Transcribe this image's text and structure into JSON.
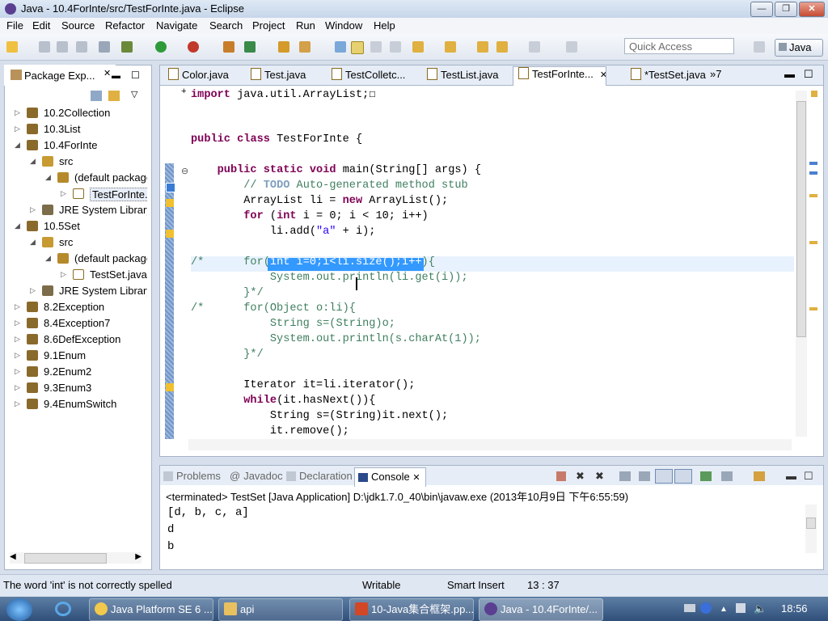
{
  "window": {
    "title": "Java - 10.4ForInte/src/TestForInte.java - Eclipse",
    "min": "—",
    "max": "❐",
    "close": "✕"
  },
  "menu": [
    "File",
    "Edit",
    "Source",
    "Refactor",
    "Navigate",
    "Search",
    "Project",
    "Run",
    "Window",
    "Help"
  ],
  "toolbar": {
    "quick_access_placeholder": "Quick Access",
    "perspective": "Java"
  },
  "package_explorer": {
    "title": "Package Exp...",
    "tree": [
      {
        "label": "10.2Collection",
        "level": 0,
        "twisty": "▷",
        "icon": "proj"
      },
      {
        "label": "10.3List",
        "level": 0,
        "twisty": "▷",
        "icon": "proj"
      },
      {
        "label": "10.4ForInte",
        "level": 0,
        "twisty": "◢",
        "icon": "proj"
      },
      {
        "label": "src",
        "level": 1,
        "twisty": "◢",
        "icon": "src"
      },
      {
        "label": "(default package)",
        "level": 2,
        "twisty": "◢",
        "icon": "pkg"
      },
      {
        "label": "TestForInte.java",
        "level": 3,
        "twisty": "▷",
        "icon": "jfile"
      },
      {
        "label": "JRE System Library",
        "level": 1,
        "twisty": "▷",
        "icon": "lib"
      },
      {
        "label": "10.5Set",
        "level": 0,
        "twisty": "◢",
        "icon": "proj"
      },
      {
        "label": "src",
        "level": 1,
        "twisty": "◢",
        "icon": "src"
      },
      {
        "label": "(default package)",
        "level": 2,
        "twisty": "◢",
        "icon": "pkg"
      },
      {
        "label": "TestSet.java",
        "level": 3,
        "twisty": "▷",
        "icon": "jfile"
      },
      {
        "label": "JRE System Library",
        "level": 1,
        "twisty": "▷",
        "icon": "lib"
      },
      {
        "label": "8.2Exception",
        "level": 0,
        "twisty": "▷",
        "icon": "proj"
      },
      {
        "label": "8.4Exception7",
        "level": 0,
        "twisty": "▷",
        "icon": "proj"
      },
      {
        "label": "8.6DefException",
        "level": 0,
        "twisty": "▷",
        "icon": "proj"
      },
      {
        "label": "9.1Enum",
        "level": 0,
        "twisty": "▷",
        "icon": "proj"
      },
      {
        "label": "9.2Enum2",
        "level": 0,
        "twisty": "▷",
        "icon": "proj"
      },
      {
        "label": "9.3Enum3",
        "level": 0,
        "twisty": "▷",
        "icon": "proj"
      },
      {
        "label": "9.4EnumSwitch",
        "level": 0,
        "twisty": "▷",
        "icon": "proj"
      }
    ]
  },
  "editor": {
    "tabs": [
      {
        "label": "Color.java",
        "active": false
      },
      {
        "label": "Test.java",
        "active": false
      },
      {
        "label": "TestColletc...",
        "active": false
      },
      {
        "label": "TestList.java",
        "active": false
      },
      {
        "label": "TestForInte...",
        "active": true,
        "close": "✕"
      },
      {
        "label": "*TestSet.java",
        "active": false
      }
    ],
    "overflow": "»7"
  },
  "code_lines": [
    {
      "parts": [
        {
          "t": "+",
          "c": ""
        },
        {
          "t": "import",
          "c": "kw"
        },
        {
          "t": " java.util.ArrayList;",
          "c": ""
        },
        {
          "t": "☐",
          "c": ""
        }
      ]
    },
    {
      "parts": []
    },
    {
      "parts": []
    },
    {
      "parts": [
        {
          "t": "public",
          "c": "kw"
        },
        {
          "t": " ",
          "c": ""
        },
        {
          "t": "class",
          "c": "kw"
        },
        {
          "t": " TestForInte {",
          "c": ""
        }
      ]
    },
    {
      "parts": []
    },
    {
      "parts": [
        {
          "t": "    ",
          "c": ""
        },
        {
          "t": "public",
          "c": "kw"
        },
        {
          "t": " ",
          "c": ""
        },
        {
          "t": "static",
          "c": "kw"
        },
        {
          "t": " ",
          "c": ""
        },
        {
          "t": "void",
          "c": "kw"
        },
        {
          "t": " main(String[] args) {",
          "c": ""
        }
      ]
    },
    {
      "parts": [
        {
          "t": "        ",
          "c": ""
        },
        {
          "t": "// ",
          "c": "cm"
        },
        {
          "t": "TODO",
          "c": "cmk"
        },
        {
          "t": " Auto-generated method stub",
          "c": "cm"
        }
      ]
    },
    {
      "parts": [
        {
          "t": "        ArrayList li = ",
          "c": ""
        },
        {
          "t": "new",
          "c": "kw"
        },
        {
          "t": " ArrayList();",
          "c": ""
        }
      ]
    },
    {
      "parts": [
        {
          "t": "        ",
          "c": ""
        },
        {
          "t": "for",
          "c": "kw"
        },
        {
          "t": " (",
          "c": ""
        },
        {
          "t": "int",
          "c": "kw"
        },
        {
          "t": " i = 0; i < 10; i++)",
          "c": ""
        }
      ]
    },
    {
      "parts": [
        {
          "t": "            li.add(",
          "c": ""
        },
        {
          "t": "\"a\"",
          "c": "str"
        },
        {
          "t": " + i);",
          "c": ""
        }
      ]
    },
    {
      "parts": []
    },
    {
      "parts": [
        {
          "t": "/*      for(",
          "c": "cm"
        },
        {
          "t": "int i=0;i<li.size();i++",
          "c": "cm"
        },
        {
          "t": "){",
          "c": "cm"
        }
      ]
    },
    {
      "parts": [
        {
          "t": "            System.out.println(li.get(i));",
          "c": "cm"
        }
      ]
    },
    {
      "parts": [
        {
          "t": "        }*/",
          "c": "cm"
        }
      ]
    },
    {
      "parts": [
        {
          "t": "/*      for(Object o:li){",
          "c": "cm"
        }
      ]
    },
    {
      "parts": [
        {
          "t": "            String s=(String)o;",
          "c": "cm"
        }
      ]
    },
    {
      "parts": [
        {
          "t": "            System.out.println(s.charAt(1));",
          "c": "cm"
        }
      ]
    },
    {
      "parts": [
        {
          "t": "        }*/",
          "c": "cm"
        }
      ]
    },
    {
      "parts": []
    },
    {
      "parts": [
        {
          "t": "        Iterator it=li.iterator();",
          "c": ""
        }
      ]
    },
    {
      "parts": [
        {
          "t": "        ",
          "c": ""
        },
        {
          "t": "while",
          "c": "kw"
        },
        {
          "t": "(it.hasNext()){",
          "c": ""
        }
      ]
    },
    {
      "parts": [
        {
          "t": "            String s=(String)it.next();",
          "c": ""
        }
      ]
    },
    {
      "parts": [
        {
          "t": "            it.remove();",
          "c": ""
        }
      ]
    }
  ],
  "console": {
    "tabs": [
      "Problems",
      "Javadoc",
      "Declaration",
      "Console"
    ],
    "active_tab": "Console",
    "terminated": "<terminated> TestSet [Java Application] D:\\jdk1.7.0_40\\bin\\javaw.exe (2013年10月9日 下午6:55:59)",
    "output": [
      "[d, b, c, a]",
      "d",
      "b"
    ]
  },
  "status": {
    "message": "The word 'int' is not correctly spelled",
    "writable": "Writable",
    "insert_mode": "Smart Insert",
    "position": "13 : 37"
  },
  "taskbar": {
    "items": [
      "Java Platform SE 6 ...",
      "api",
      "10-Java集合框架.pp...",
      "Java - 10.4ForInte/..."
    ],
    "clock": "18:56"
  },
  "colors": {
    "keyword": "#7f0055",
    "comment": "#3f7f5f",
    "string": "#2a00ff",
    "selection": "#3399ff"
  }
}
